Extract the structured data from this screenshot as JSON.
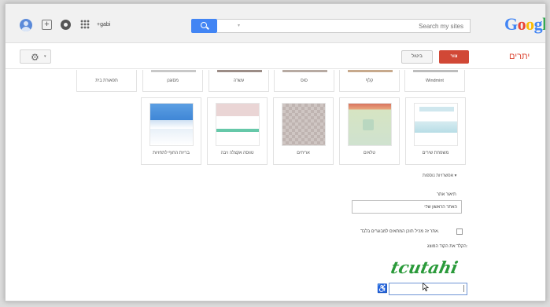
{
  "header": {
    "user_name": "+gabi",
    "search_placeholder": "Search my sites",
    "logo_letters": [
      {
        "ch": "G",
        "color": "#4285f4"
      },
      {
        "ch": "o",
        "color": "#ea4335"
      },
      {
        "ch": "o",
        "color": "#fbbc05"
      },
      {
        "ch": "g",
        "color": "#4285f4"
      },
      {
        "ch": "l",
        "color": "#34a853"
      }
    ],
    "icons": [
      "avatar-icon",
      "plus-icon",
      "notifications-icon",
      "apps-grid-icon",
      "search-icon"
    ]
  },
  "toolbar": {
    "sites_title": "יתרים",
    "create_label": "צור",
    "cancel_label": "ביטול",
    "settings_icon": "gear-icon",
    "settings_caret": "▾"
  },
  "templates_row1": [
    {
      "label": "Windmint",
      "accent": "#bdbdbd"
    },
    {
      "label": "קלף",
      "accent": "#c7a98c"
    },
    {
      "label": "סוס",
      "accent": "#b7aaa2"
    },
    {
      "label": "עשרה",
      "accent": "#9b8c86"
    },
    {
      "label": "מסוגנן",
      "accent": "#c8c8c8"
    },
    {
      "label": "תפאורת בית",
      "accent": "#ffffff"
    }
  ],
  "templates_row2": [
    {
      "label": "משפחת שירים"
    },
    {
      "label": "טלאים"
    },
    {
      "label": "אריחים"
    },
    {
      "label": "טווסה אקצלה ויבה"
    },
    {
      "label": "בריזת החוף לתחזיות"
    }
  ],
  "form": {
    "more_options": "אפשרויות נוספות ▾",
    "description_label": "תיאור אתר",
    "description_value": "האתר הראשון שלי",
    "adult_content_label": "אתר זה מכיל תוכן המתאים למבוגרים בלבד.",
    "captcha_label": "הקלד את הקוד המוצג:",
    "captcha_text": "tcutahi",
    "captcha_color": "#2a9a3a"
  }
}
